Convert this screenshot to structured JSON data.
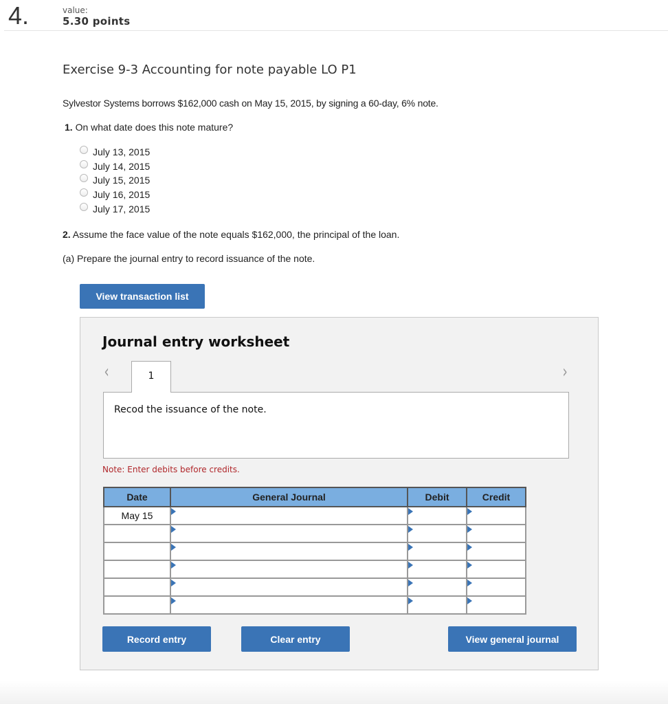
{
  "question": {
    "number": "4.",
    "value_label": "value:",
    "value": "5.30 points"
  },
  "exercise": {
    "title": "Exercise 9-3 Accounting for note payable LO P1",
    "problem_text": "Sylvestor Systems borrows $162,000 cash on May 15, 2015, by signing a 60-day, 6% note.",
    "q1_num": "1.",
    "q1_text": " On what date does this note mature?",
    "options": [
      {
        "label": "July 13, 2015",
        "selected": false
      },
      {
        "label": "July 14, 2015",
        "selected": false
      },
      {
        "label": "July 15, 2015",
        "selected": false
      },
      {
        "label": "July 16, 2015",
        "selected": false
      },
      {
        "label": "July 17, 2015",
        "selected": false
      }
    ],
    "q2_num": "2.",
    "q2_text": " Assume the face value of the note equals $162,000, the principal of the loan.",
    "q2a_text": "(a) Prepare the journal entry to record issuance of the note."
  },
  "buttons": {
    "view_transaction_list": "View transaction list",
    "record_entry": "Record entry",
    "clear_entry": "Clear entry",
    "view_general_journal": "View general journal"
  },
  "worksheet": {
    "title": "Journal entry worksheet",
    "prev_icon": "‹",
    "next_icon": "›",
    "active_tab": "1",
    "description": "Recod the issuance of the note.",
    "note": "Note: Enter debits before credits.",
    "columns": [
      "Date",
      "General Journal",
      "Debit",
      "Credit"
    ],
    "rows": [
      {
        "date": "May 15",
        "account": "",
        "debit": "",
        "credit": ""
      },
      {
        "date": "",
        "account": "",
        "debit": "",
        "credit": ""
      },
      {
        "date": "",
        "account": "",
        "debit": "",
        "credit": ""
      },
      {
        "date": "",
        "account": "",
        "debit": "",
        "credit": ""
      },
      {
        "date": "",
        "account": "",
        "debit": "",
        "credit": ""
      },
      {
        "date": "",
        "account": "",
        "debit": "",
        "credit": ""
      }
    ]
  },
  "colors": {
    "button_blue": "#3a74b6",
    "table_header": "#7aaee0",
    "note_red": "#b0272b",
    "panel_bg": "#f2f2f2"
  }
}
